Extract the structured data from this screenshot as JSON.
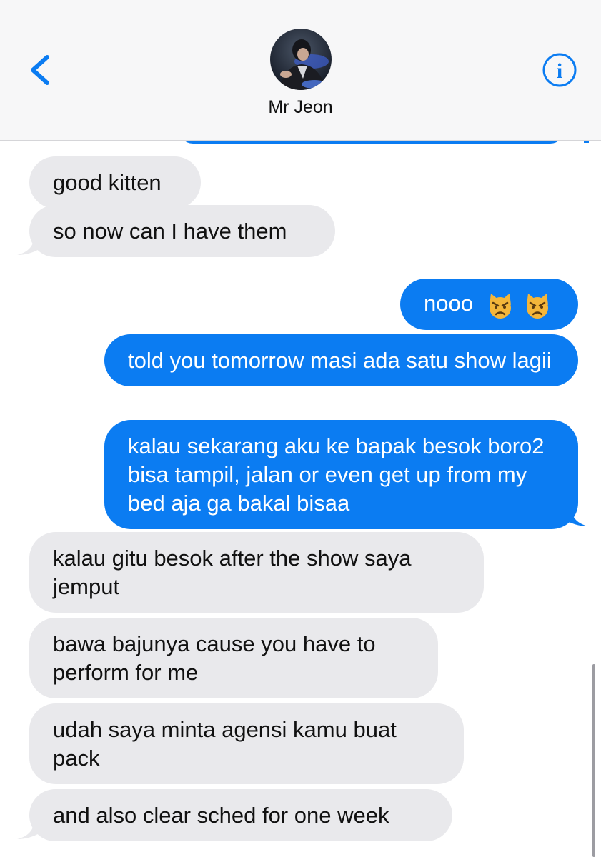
{
  "header": {
    "contact_name": "Mr Jeon",
    "back_icon": "chevron-left-icon",
    "info_icon": "info-circle-icon",
    "accent_color": "#0b7cf2"
  },
  "messages": [
    {
      "direction": "incoming",
      "text": "good kitten"
    },
    {
      "direction": "incoming",
      "text": "so now can I have them"
    },
    {
      "direction": "outgoing",
      "text": "nooo",
      "emoji": [
        "pouting-cat-emoji",
        "pouting-cat-emoji"
      ]
    },
    {
      "direction": "outgoing",
      "text": "told you tomorrow masi ada satu show lagii"
    },
    {
      "direction": "outgoing",
      "text": "kalau sekarang aku ke bapak besok boro2 bisa tampil, jalan or even get up from my bed aja ga bakal bisaa"
    },
    {
      "direction": "incoming",
      "text": "kalau gitu besok after the show saya jemput"
    },
    {
      "direction": "incoming",
      "text": "bawa bajunya cause you have to perform for me"
    },
    {
      "direction": "incoming",
      "text": "udah saya minta agensi kamu buat pack"
    },
    {
      "direction": "incoming",
      "text": "and also clear sched for one week"
    }
  ],
  "colors": {
    "incoming_bubble": "#e9e9ec",
    "outgoing_bubble": "#0b7cf2",
    "header_bg": "#f7f7f8"
  }
}
